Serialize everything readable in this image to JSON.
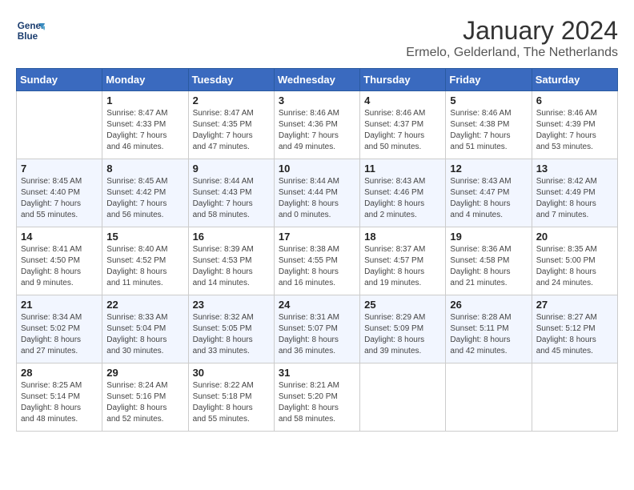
{
  "header": {
    "logo_line1": "General",
    "logo_line2": "Blue",
    "title": "January 2024",
    "subtitle": "Ermelo, Gelderland, The Netherlands"
  },
  "weekdays": [
    "Sunday",
    "Monday",
    "Tuesday",
    "Wednesday",
    "Thursday",
    "Friday",
    "Saturday"
  ],
  "weeks": [
    [
      {
        "day": "",
        "info": ""
      },
      {
        "day": "1",
        "info": "Sunrise: 8:47 AM\nSunset: 4:33 PM\nDaylight: 7 hours\nand 46 minutes."
      },
      {
        "day": "2",
        "info": "Sunrise: 8:47 AM\nSunset: 4:35 PM\nDaylight: 7 hours\nand 47 minutes."
      },
      {
        "day": "3",
        "info": "Sunrise: 8:46 AM\nSunset: 4:36 PM\nDaylight: 7 hours\nand 49 minutes."
      },
      {
        "day": "4",
        "info": "Sunrise: 8:46 AM\nSunset: 4:37 PM\nDaylight: 7 hours\nand 50 minutes."
      },
      {
        "day": "5",
        "info": "Sunrise: 8:46 AM\nSunset: 4:38 PM\nDaylight: 7 hours\nand 51 minutes."
      },
      {
        "day": "6",
        "info": "Sunrise: 8:46 AM\nSunset: 4:39 PM\nDaylight: 7 hours\nand 53 minutes."
      }
    ],
    [
      {
        "day": "7",
        "info": "Sunrise: 8:45 AM\nSunset: 4:40 PM\nDaylight: 7 hours\nand 55 minutes."
      },
      {
        "day": "8",
        "info": "Sunrise: 8:45 AM\nSunset: 4:42 PM\nDaylight: 7 hours\nand 56 minutes."
      },
      {
        "day": "9",
        "info": "Sunrise: 8:44 AM\nSunset: 4:43 PM\nDaylight: 7 hours\nand 58 minutes."
      },
      {
        "day": "10",
        "info": "Sunrise: 8:44 AM\nSunset: 4:44 PM\nDaylight: 8 hours\nand 0 minutes."
      },
      {
        "day": "11",
        "info": "Sunrise: 8:43 AM\nSunset: 4:46 PM\nDaylight: 8 hours\nand 2 minutes."
      },
      {
        "day": "12",
        "info": "Sunrise: 8:43 AM\nSunset: 4:47 PM\nDaylight: 8 hours\nand 4 minutes."
      },
      {
        "day": "13",
        "info": "Sunrise: 8:42 AM\nSunset: 4:49 PM\nDaylight: 8 hours\nand 7 minutes."
      }
    ],
    [
      {
        "day": "14",
        "info": "Sunrise: 8:41 AM\nSunset: 4:50 PM\nDaylight: 8 hours\nand 9 minutes."
      },
      {
        "day": "15",
        "info": "Sunrise: 8:40 AM\nSunset: 4:52 PM\nDaylight: 8 hours\nand 11 minutes."
      },
      {
        "day": "16",
        "info": "Sunrise: 8:39 AM\nSunset: 4:53 PM\nDaylight: 8 hours\nand 14 minutes."
      },
      {
        "day": "17",
        "info": "Sunrise: 8:38 AM\nSunset: 4:55 PM\nDaylight: 8 hours\nand 16 minutes."
      },
      {
        "day": "18",
        "info": "Sunrise: 8:37 AM\nSunset: 4:57 PM\nDaylight: 8 hours\nand 19 minutes."
      },
      {
        "day": "19",
        "info": "Sunrise: 8:36 AM\nSunset: 4:58 PM\nDaylight: 8 hours\nand 21 minutes."
      },
      {
        "day": "20",
        "info": "Sunrise: 8:35 AM\nSunset: 5:00 PM\nDaylight: 8 hours\nand 24 minutes."
      }
    ],
    [
      {
        "day": "21",
        "info": "Sunrise: 8:34 AM\nSunset: 5:02 PM\nDaylight: 8 hours\nand 27 minutes."
      },
      {
        "day": "22",
        "info": "Sunrise: 8:33 AM\nSunset: 5:04 PM\nDaylight: 8 hours\nand 30 minutes."
      },
      {
        "day": "23",
        "info": "Sunrise: 8:32 AM\nSunset: 5:05 PM\nDaylight: 8 hours\nand 33 minutes."
      },
      {
        "day": "24",
        "info": "Sunrise: 8:31 AM\nSunset: 5:07 PM\nDaylight: 8 hours\nand 36 minutes."
      },
      {
        "day": "25",
        "info": "Sunrise: 8:29 AM\nSunset: 5:09 PM\nDaylight: 8 hours\nand 39 minutes."
      },
      {
        "day": "26",
        "info": "Sunrise: 8:28 AM\nSunset: 5:11 PM\nDaylight: 8 hours\nand 42 minutes."
      },
      {
        "day": "27",
        "info": "Sunrise: 8:27 AM\nSunset: 5:12 PM\nDaylight: 8 hours\nand 45 minutes."
      }
    ],
    [
      {
        "day": "28",
        "info": "Sunrise: 8:25 AM\nSunset: 5:14 PM\nDaylight: 8 hours\nand 48 minutes."
      },
      {
        "day": "29",
        "info": "Sunrise: 8:24 AM\nSunset: 5:16 PM\nDaylight: 8 hours\nand 52 minutes."
      },
      {
        "day": "30",
        "info": "Sunrise: 8:22 AM\nSunset: 5:18 PM\nDaylight: 8 hours\nand 55 minutes."
      },
      {
        "day": "31",
        "info": "Sunrise: 8:21 AM\nSunset: 5:20 PM\nDaylight: 8 hours\nand 58 minutes."
      },
      {
        "day": "",
        "info": ""
      },
      {
        "day": "",
        "info": ""
      },
      {
        "day": "",
        "info": ""
      }
    ]
  ]
}
